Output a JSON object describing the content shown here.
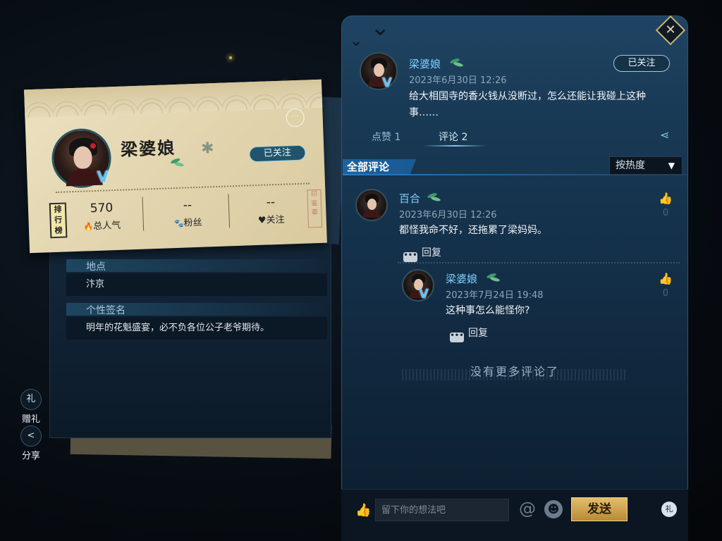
{
  "profile": {
    "name": "梁婆娘",
    "follow_label": "已关注",
    "more_label": "···",
    "rank_badge": "排行榜",
    "stats": [
      {
        "value": "570",
        "label": "总人气",
        "icon": "fire-icon",
        "icon_glyph": "🔥"
      },
      {
        "value": "--",
        "label": "粉丝",
        "icon": "paw-icon",
        "icon_glyph": "🐾"
      },
      {
        "value": "--",
        "label": "关注",
        "icon": "heart-icon",
        "icon_glyph": "♥"
      }
    ],
    "location_label": "地点",
    "location_value": "汴京",
    "signature_label": "个性签名",
    "signature_value": "明年的花魁盛宴，必不负各位公子老爷期待。"
  },
  "side_buttons": {
    "gift_label": "赠礼",
    "gift_glyph": "礼",
    "share_label": "分享",
    "share_glyph": "<"
  },
  "post": {
    "author": "梁婆娘",
    "time": "2023年6月30日 12:26",
    "content": "给大相国寺的香火钱从没断过，怎么还能让我碰上这种事……",
    "follow_label": "已关注",
    "tabs": [
      {
        "label": "点赞 1",
        "active": false
      },
      {
        "label": "评论 2",
        "active": true
      }
    ]
  },
  "comments_header": {
    "title": "全部评论",
    "sort_value": "按热度"
  },
  "comments": [
    {
      "author": "百合",
      "time": "2023年6月30日 12:26",
      "text": "都怪我命不好，还拖累了梁妈妈。",
      "likes": "0",
      "reply_label": "回复"
    },
    {
      "author": "梁婆娘",
      "time": "2023年7月24日 19:48",
      "text": "这种事怎么能怪你?",
      "likes": "0",
      "reply_label": "回复"
    }
  ],
  "no_more_text": "没有更多评论了",
  "composer": {
    "placeholder": "留下你的想法吧",
    "send_label": "发送",
    "at_glyph": "@",
    "emoji_glyph": "☻",
    "gift_glyph": "礼"
  },
  "colors": {
    "accent_blue": "#7fd0ff",
    "send_gold": "#d4a74f",
    "verified_blue": "#5fc4ff"
  }
}
